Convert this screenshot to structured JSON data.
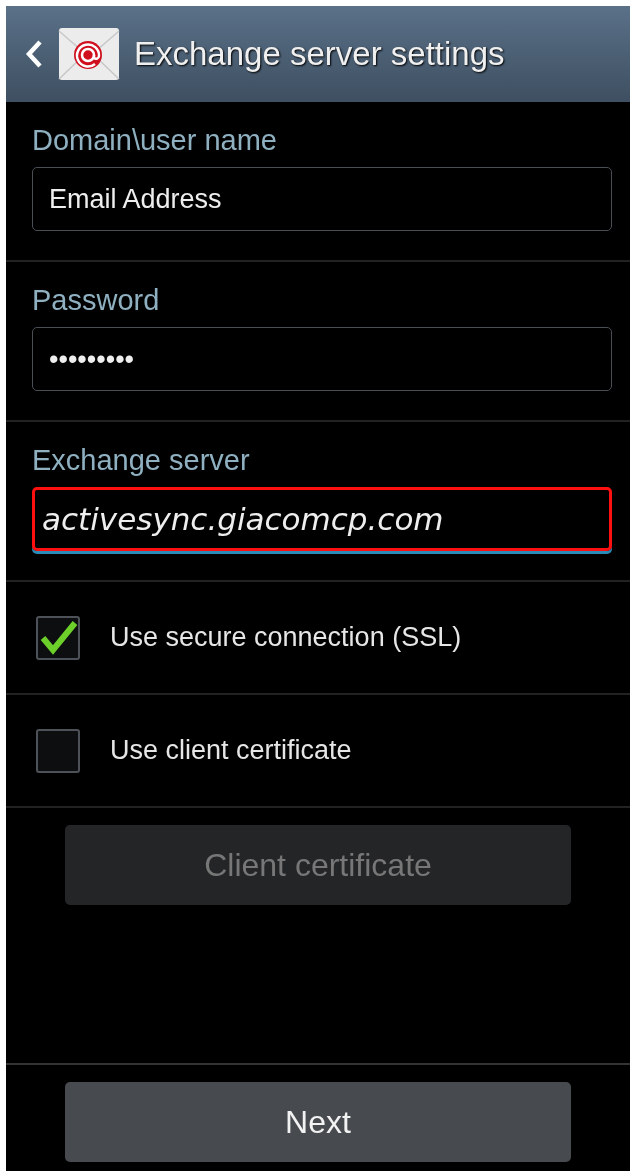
{
  "header": {
    "title": "Exchange server settings"
  },
  "fields": [
    {
      "label": "Domain\\user name",
      "value": "Email Address",
      "italic": false,
      "highlighted": false
    },
    {
      "label": "Password",
      "value": "•••••••••",
      "italic": false,
      "highlighted": false
    },
    {
      "label": "Exchange server",
      "value": "activesync.giacomcp.com",
      "italic": true,
      "highlighted": true
    }
  ],
  "options": [
    {
      "label": "Use secure connection (SSL)",
      "checked": true
    },
    {
      "label": "Use client certificate",
      "checked": false
    }
  ],
  "certificate_button": {
    "label": "Client certificate",
    "disabled": true
  },
  "next_button": {
    "label": "Next",
    "disabled": false
  }
}
